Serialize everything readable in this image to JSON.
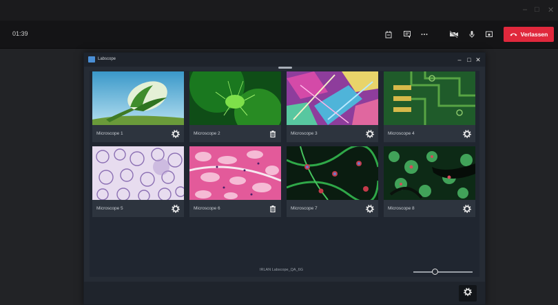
{
  "call": {
    "timer": "01:39",
    "leave_label": "Verlassen",
    "colors": {
      "leave": "#e0283c",
      "bar": "#141416"
    }
  },
  "window_controls": {
    "minimize": "–",
    "maximize": "□",
    "close": "✕"
  },
  "app": {
    "name": "Labscope",
    "status": "IRLAN Labscope_QA_6G",
    "zoom_fraction": 0.36
  },
  "cards": [
    {
      "label": "Microscope 1",
      "action": "settings-icon"
    },
    {
      "label": "Microscope 2",
      "action": "trash-icon"
    },
    {
      "label": "Microscope 3",
      "action": "settings-icon"
    },
    {
      "label": "Microscope 4",
      "action": "settings-icon"
    },
    {
      "label": "Microscope 5",
      "action": "settings-icon"
    },
    {
      "label": "Microscope 6",
      "action": "trash-icon"
    },
    {
      "label": "Microscope 7",
      "action": "settings-icon"
    },
    {
      "label": "Microscope 8",
      "action": "settings-icon"
    }
  ]
}
